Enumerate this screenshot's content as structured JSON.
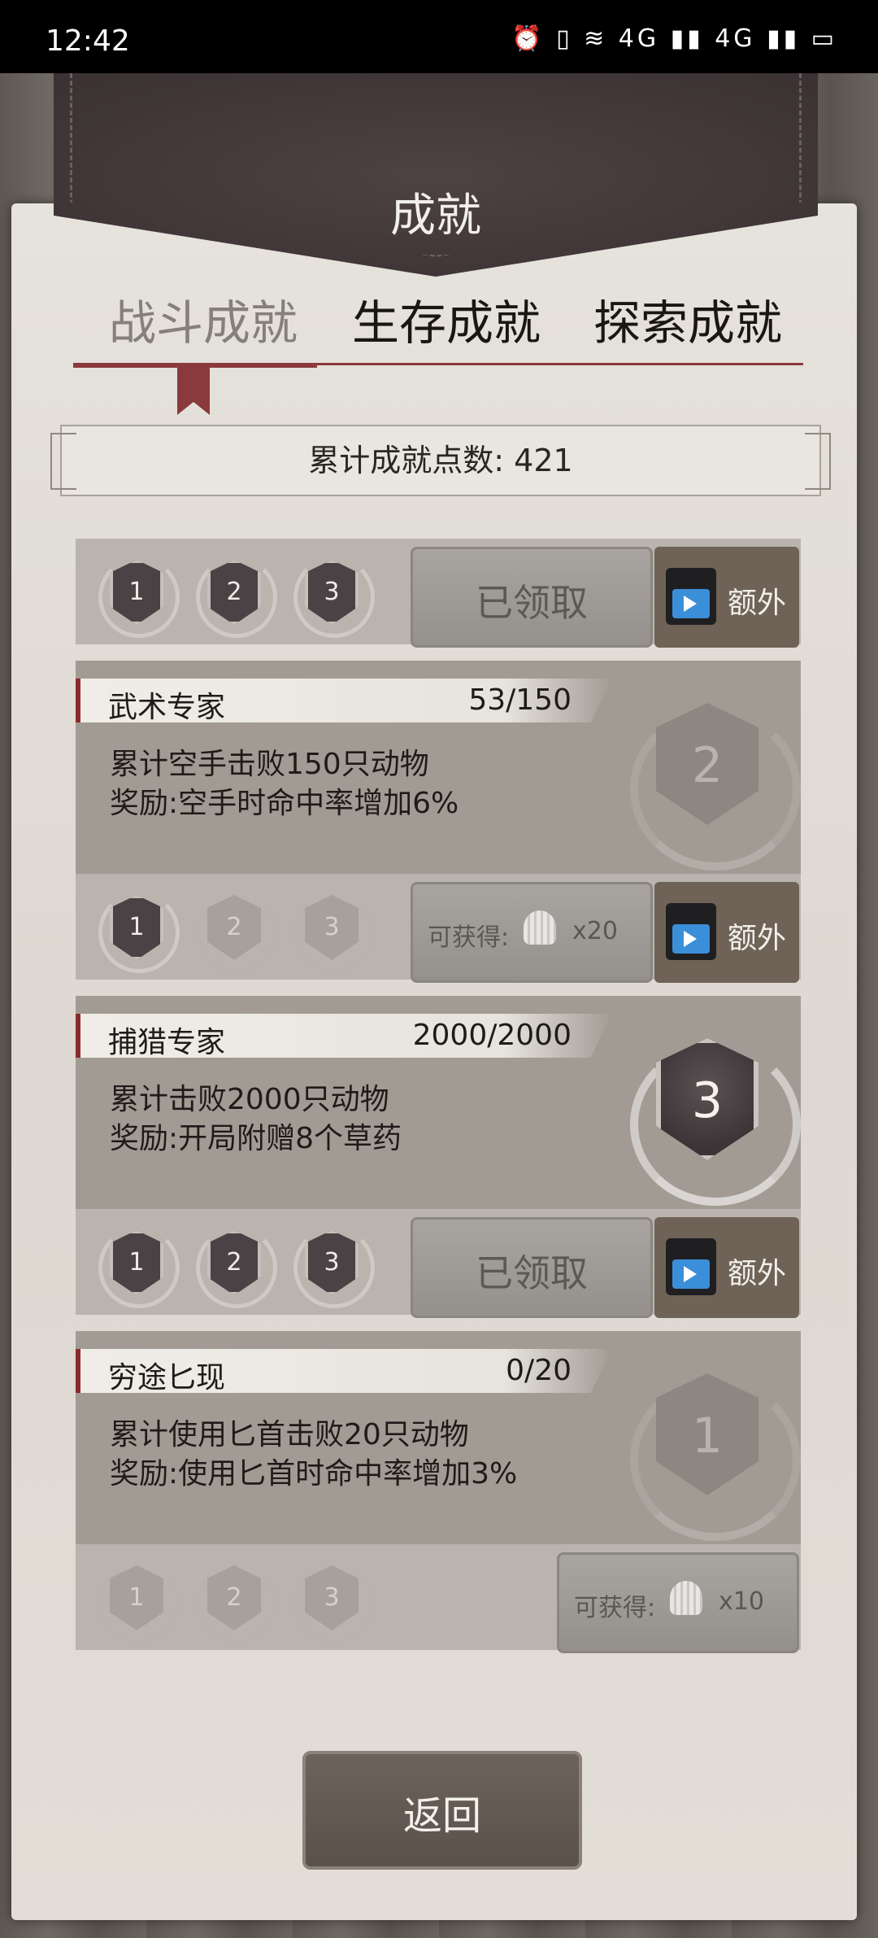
{
  "status": {
    "time": "12:42",
    "icons": "⏰ ▯ ≋ 4G ▮▮ 4G ▮▮ ▭"
  },
  "header": {
    "title": "成就"
  },
  "tabs": [
    {
      "label": "战斗成就",
      "active": true
    },
    {
      "label": "生存成就",
      "active": false
    },
    {
      "label": "探索成就",
      "active": false
    }
  ],
  "points": {
    "text": "累计成就点数: 421"
  },
  "cards": [
    {
      "name": "",
      "progress": "",
      "desc": [
        "",
        ""
      ],
      "badge": "",
      "medals": [
        "1",
        "2",
        "3"
      ],
      "medals_on": [
        true,
        true,
        true
      ],
      "button": "已领取",
      "extra": "额外"
    },
    {
      "name": "武术专家",
      "progress": "53/150",
      "desc": [
        "累计空手击败150只动物",
        "奖励:空手时命中率增加6%"
      ],
      "badge": "2",
      "medals": [
        "1",
        "2",
        "3"
      ],
      "medals_on": [
        true,
        false,
        false
      ],
      "reward_label": "可获得:",
      "reward_qty": "x20",
      "extra": "额外"
    },
    {
      "name": "捕猎专家",
      "progress": "2000/2000",
      "desc": [
        "累计击败2000只动物",
        "奖励:开局附赠8个草药"
      ],
      "badge": "3",
      "medals": [
        "1",
        "2",
        "3"
      ],
      "medals_on": [
        true,
        true,
        true
      ],
      "button": "已领取",
      "extra": "额外"
    },
    {
      "name": "穷途匕现",
      "progress": "0/20",
      "desc": [
        "累计使用匕首击败20只动物",
        "奖励:使用匕首时命中率增加3%"
      ],
      "badge": "1",
      "medals": [
        "1",
        "2",
        "3"
      ],
      "medals_on": [
        false,
        false,
        false
      ],
      "reward_label": "可获得:",
      "reward_qty": "x10"
    }
  ],
  "footer": {
    "back_label": "返回"
  },
  "colors": {
    "accent": "#8a3a3c",
    "leather": "#3a3133",
    "parchment": "#e2ded7"
  }
}
